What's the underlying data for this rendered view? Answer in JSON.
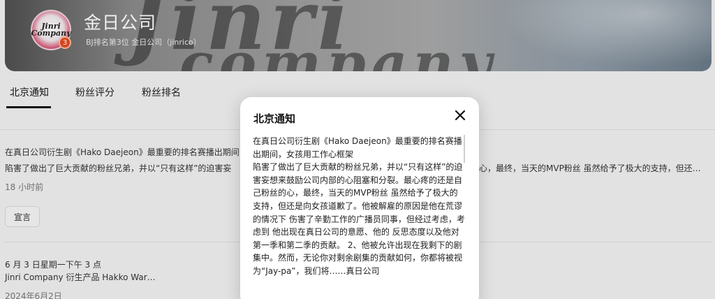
{
  "channel": {
    "name": "金日公司",
    "subtitle": "BJ排名第3位  金日公司（jinrico）",
    "avatar_text": "Jinri Company",
    "avatar_badge": "3",
    "banner_art": "Jinri",
    "banner_art2": "company"
  },
  "tabs": [
    {
      "label": "北京通知",
      "active": true
    },
    {
      "label": "粉丝评分",
      "active": false
    },
    {
      "label": "粉丝排名",
      "active": false
    }
  ],
  "feed": {
    "post1": {
      "line1": "在真日公司衍生剧《Hako Daejeon》最重要的排名赛播出期间",
      "line2_left": "陷害了做出了巨大贡献的粉丝兄弟，并以“只有这样”的迫害妄",
      "line2_right": "心，最终，当天的MVP粉丝 虽然给予了极大的支持，但还…",
      "time": "18 小时前",
      "tag": "宣言"
    },
    "post2": {
      "date_line": "6 月 3 日星期一下午 3 点",
      "title": "Jinri Company 衍生产品 Hakko War…",
      "date": "2024年6月2日"
    }
  },
  "modal": {
    "title": "北京通知",
    "close_icon": "close-icon",
    "body": "在真日公司衍生剧《Hako Daejeon》最重要的排名赛播出期间，女孩用工作心框架\n陷害了做出了巨大贡献的粉丝兄弟，并以“只有这样”的迫害妄想来鼓励公司内部的心阻塞和分裂。最心疼的还是自己粉丝的心，最终，当天的MVP粉丝 虽然给予了极大的支持，但还是向女孩道歉了。他被解雇的原因是他在荒谬的情况下 伤害了辛勤工作的广播员同事，但经过考虑，考虑到 他出现在真日公司的意愿、他的 反思态度以及他对第一季和第二季的贡献。 2、他被允许出现在我剩下的剧集中。然而，无论你对剩余剧集的贡献如何，你都将被视为“Jay-pa”，我们将……真日公司"
  }
}
